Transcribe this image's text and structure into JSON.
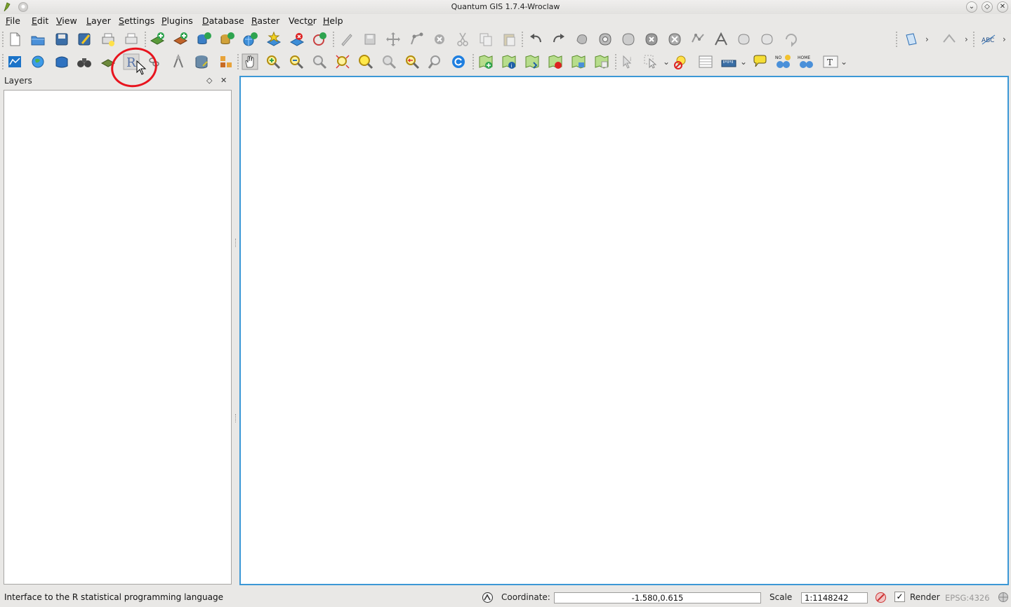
{
  "window": {
    "title": "Quantum GIS 1.7.4-Wroclaw"
  },
  "menu": {
    "items": [
      {
        "pre": "",
        "u": "F",
        "post": "ile"
      },
      {
        "pre": "",
        "u": "E",
        "post": "dit"
      },
      {
        "pre": "",
        "u": "V",
        "post": "iew"
      },
      {
        "pre": "",
        "u": "L",
        "post": "ayer"
      },
      {
        "pre": "",
        "u": "S",
        "post": "ettings"
      },
      {
        "pre": "",
        "u": "P",
        "post": "lugins"
      },
      {
        "pre": "",
        "u": "D",
        "post": "atabase"
      },
      {
        "pre": "",
        "u": "R",
        "post": "aster"
      },
      {
        "pre": "Vect",
        "u": "o",
        "post": "r"
      },
      {
        "pre": "",
        "u": "H",
        "post": "elp"
      }
    ]
  },
  "layers_dock": {
    "title": "Layers",
    "float_icon": "◇",
    "close_icon": "✕"
  },
  "status": {
    "message": "Interface to the R statistical programming language",
    "coordinate_label": "Coordinate:",
    "coordinate_value": "-1.580,0.615",
    "scale_label": "Scale",
    "scale_value": "1:1148242",
    "render_label": "Render",
    "render_checked": true,
    "crs": "EPSG:4326"
  },
  "colors": {
    "map_border": "#3c98d6",
    "annotation": "#e8141e"
  }
}
